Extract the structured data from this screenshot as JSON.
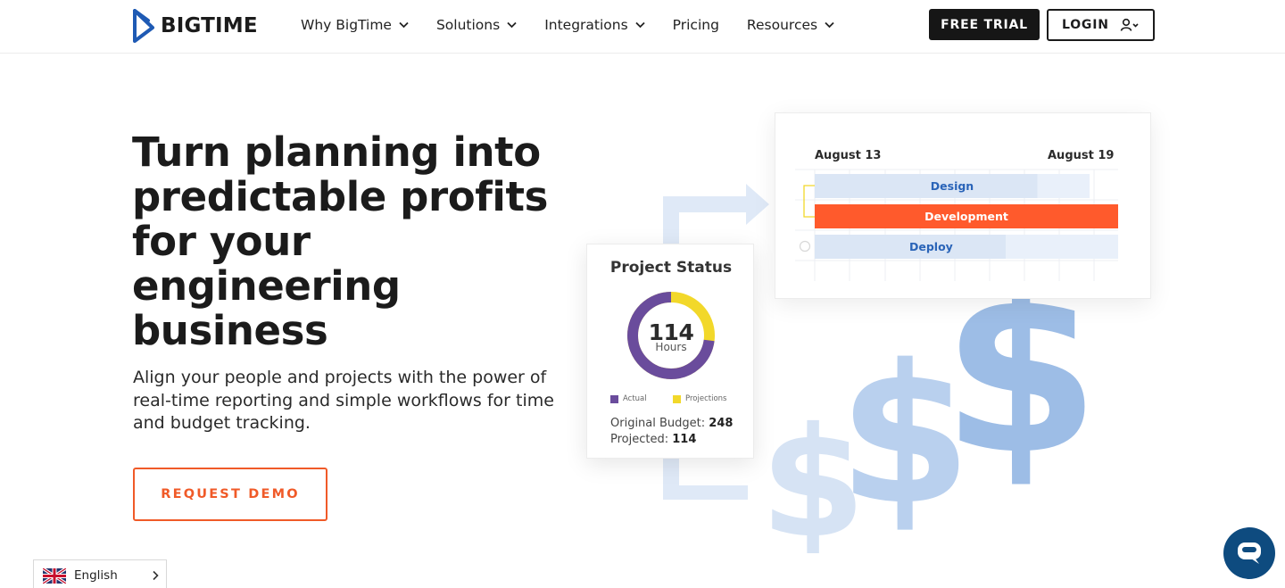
{
  "brand": {
    "name": "BIGTIME"
  },
  "nav": {
    "items": [
      {
        "label": "Why BigTime",
        "has_dropdown": true
      },
      {
        "label": "Solutions",
        "has_dropdown": true
      },
      {
        "label": "Integrations",
        "has_dropdown": true
      },
      {
        "label": "Pricing",
        "has_dropdown": false
      },
      {
        "label": "Resources",
        "has_dropdown": true
      }
    ],
    "free_trial_label": "FREE TRIAL",
    "login_label": "LOGIN"
  },
  "hero": {
    "title": "Turn planning into predictable profits for your engineering business",
    "subtitle": "Align your people and projects with the power of real-time reporting and simple workflows for time and budget tracking.",
    "cta_label": "REQUEST DEMO"
  },
  "gantt": {
    "start_date": "August 13",
    "end_date": "August 19",
    "tasks": [
      {
        "label": "Design"
      },
      {
        "label": "Development"
      },
      {
        "label": "Deploy"
      }
    ]
  },
  "project_status": {
    "title": "Project Status",
    "hours_value": "114",
    "hours_unit": "Hours",
    "actual_fraction": 0.73,
    "legend_actual": "Actual",
    "legend_projections": "Projections",
    "original_budget_label": "Original Budget:",
    "original_budget_value": "248",
    "projected_label": "Projected:",
    "projected_value": "114"
  },
  "language": {
    "label": "English"
  },
  "colors": {
    "accent_orange": "#f05a28",
    "brand_blue": "#1e5ab4",
    "purple": "#6a4c9c",
    "yellow": "#f2d82a",
    "bar_light": "#dbe6f5",
    "dollar_dark": "#9dbde6",
    "dollar_light": "#d6e3f4",
    "chat_blue": "#0e4b7f"
  }
}
